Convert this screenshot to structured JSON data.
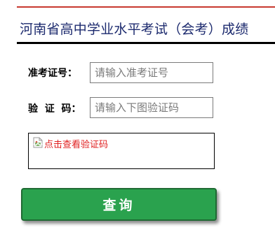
{
  "header": {
    "title": "河南省高中学业水平考试（会考）成绩"
  },
  "form": {
    "exam_id": {
      "label": "准考证号：",
      "value": "",
      "placeholder": "请输入准考证号"
    },
    "captcha": {
      "label": "验  证  码：",
      "value": "",
      "placeholder": "请输入下图验证码"
    },
    "captcha_image": {
      "alt_text": "点击查看验证码",
      "status": "broken-image"
    },
    "submit_label": "查询"
  },
  "colors": {
    "accent_red": "#c8382e",
    "title_text": "#1c2a6e",
    "button_green": "#2aa24e",
    "alt_text_red": "#e02020"
  },
  "icons": {
    "captcha_image": "broken-image-icon"
  }
}
